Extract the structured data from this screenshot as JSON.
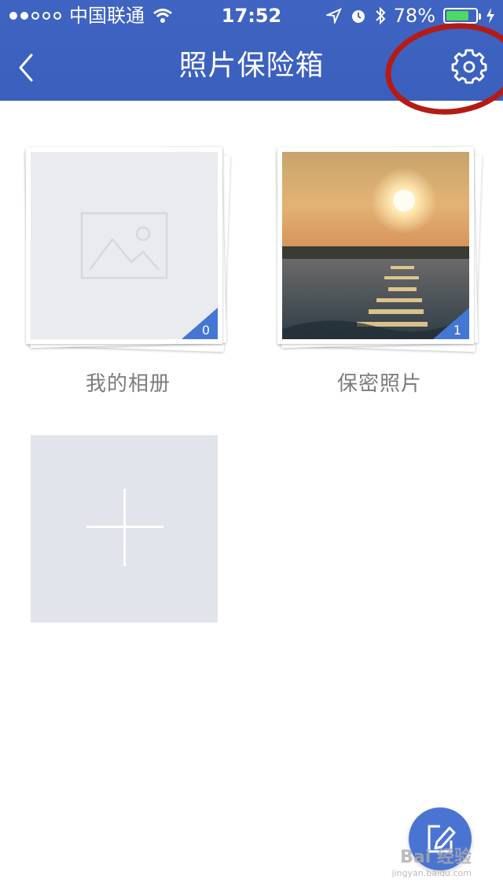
{
  "status_bar": {
    "carrier": "中国联通",
    "time": "17:52",
    "battery_percent": "78%",
    "battery_level": 0.78,
    "signal_bars": 2,
    "icons": [
      "wifi-icon",
      "location-arrow-icon",
      "alarm-icon",
      "bluetooth-icon",
      "charging-icon"
    ]
  },
  "nav": {
    "title": "照片保险箱",
    "back_icon": "chevron-left-icon",
    "settings_icon": "gear-icon"
  },
  "albums": [
    {
      "label": "我的相册",
      "count": "0",
      "has_photo": false
    },
    {
      "label": "保密照片",
      "count": "1",
      "has_photo": true
    }
  ],
  "add_album": {
    "icon": "plus-icon"
  },
  "fab": {
    "icon": "edit-icon"
  },
  "watermark": {
    "brand": "Bai 经验",
    "url": "jingyan.baidu.com"
  },
  "colors": {
    "header": "#3f64c2",
    "badge": "#4476d4",
    "highlight_circle": "#b51b14"
  }
}
